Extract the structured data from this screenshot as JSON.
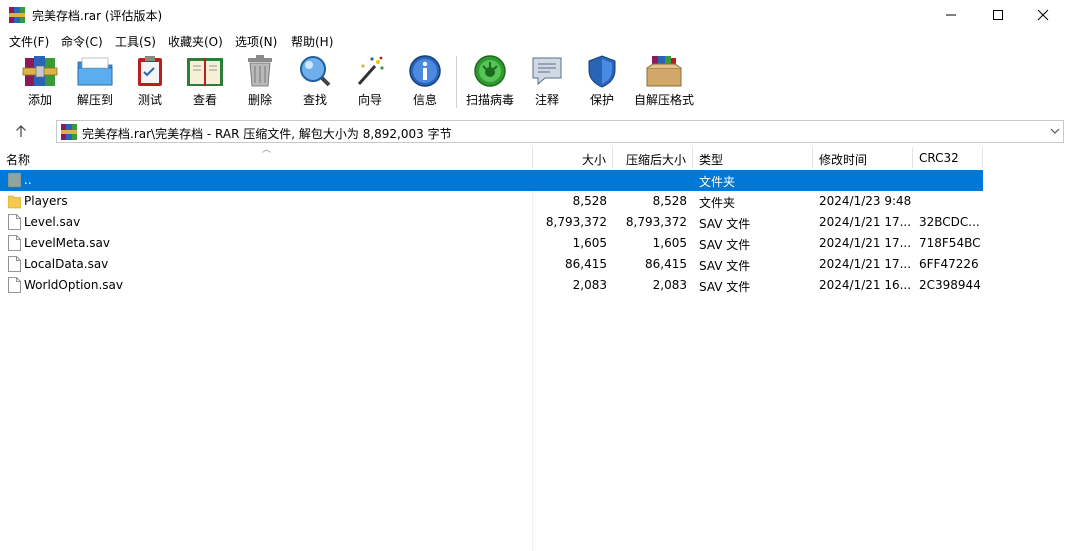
{
  "window": {
    "title": "完美存档.rar (评估版本)"
  },
  "menu": {
    "items": [
      {
        "label": "文件(F)"
      },
      {
        "label": "命令(C)"
      },
      {
        "label": "工具(S)"
      },
      {
        "label": "收藏夹(O)"
      },
      {
        "label": "选项(N)"
      },
      {
        "label": "帮助(H)"
      }
    ]
  },
  "toolbar": {
    "items": [
      {
        "label": "添加",
        "icon": "books-add-icon"
      },
      {
        "label": "解压到",
        "icon": "folder-extract-icon"
      },
      {
        "label": "测试",
        "icon": "clipboard-test-icon"
      },
      {
        "label": "查看",
        "icon": "open-book-icon"
      },
      {
        "label": "删除",
        "icon": "trash-icon"
      },
      {
        "label": "查找",
        "icon": "magnifier-icon"
      },
      {
        "label": "向导",
        "icon": "magic-wand-icon"
      },
      {
        "label": "信息",
        "icon": "info-icon"
      },
      {
        "label": "扫描病毒",
        "icon": "virus-scan-icon"
      },
      {
        "label": "注释",
        "icon": "comment-icon"
      },
      {
        "label": "保护",
        "icon": "shield-icon"
      },
      {
        "label": "自解压格式",
        "icon": "sfx-box-icon"
      }
    ]
  },
  "address": {
    "path": "完美存档.rar\\完美存档 - RAR 压缩文件, 解包大小为 8,892,003 字节"
  },
  "columns": {
    "name": "名称",
    "size": "大小",
    "packed": "压缩后大小",
    "type": "类型",
    "modified": "修改时间",
    "crc": "CRC32"
  },
  "files": [
    {
      "name": "..",
      "size": "",
      "packed": "",
      "type": "文件夹",
      "modified": "",
      "crc": "",
      "icon": "parent-folder-icon",
      "selected": true
    },
    {
      "name": "Players",
      "size": "8,528",
      "packed": "8,528",
      "type": "文件夹",
      "modified": "2024/1/23 9:48",
      "crc": "",
      "icon": "folder-icon",
      "selected": false
    },
    {
      "name": "Level.sav",
      "size": "8,793,372",
      "packed": "8,793,372",
      "type": "SAV 文件",
      "modified": "2024/1/21 17...",
      "crc": "32BCDC...",
      "icon": "file-icon",
      "selected": false
    },
    {
      "name": "LevelMeta.sav",
      "size": "1,605",
      "packed": "1,605",
      "type": "SAV 文件",
      "modified": "2024/1/21 17...",
      "crc": "718F54BC",
      "icon": "file-icon",
      "selected": false
    },
    {
      "name": "LocalData.sav",
      "size": "86,415",
      "packed": "86,415",
      "type": "SAV 文件",
      "modified": "2024/1/21 17...",
      "crc": "6FF47226",
      "icon": "file-icon",
      "selected": false
    },
    {
      "name": "WorldOption.sav",
      "size": "2,083",
      "packed": "2,083",
      "type": "SAV 文件",
      "modified": "2024/1/21 16...",
      "crc": "2C398944",
      "icon": "file-icon",
      "selected": false
    }
  ],
  "colors": {
    "selection": "#0078d7",
    "folder": "#f4c94e"
  }
}
